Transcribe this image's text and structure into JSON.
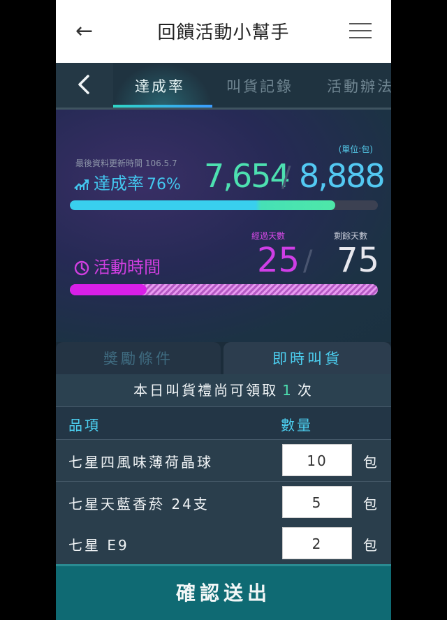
{
  "header": {
    "title": "回饋活動小幫手",
    "back_icon": "←"
  },
  "tabs": [
    {
      "label": "達成率",
      "active": true
    },
    {
      "label": "叫貨記錄",
      "active": false
    },
    {
      "label": "活動辦法",
      "active": false
    }
  ],
  "stats": {
    "unit_note": "(單位:包)",
    "last_updated": "最後資料更新時間 106.5.7",
    "rate_label": "達成率",
    "rate_percent": "76%",
    "achieved": "7,654",
    "target": "8,888",
    "separator": "/",
    "achieved_fraction": 0.861,
    "time_label": "活動時間",
    "elapsed_caption": "經過天數",
    "remaining_caption": "剩餘天數",
    "elapsed_days": "25",
    "remaining_days": "75",
    "elapsed_fraction": 0.25
  },
  "subtabs": [
    {
      "label": "獎勵條件",
      "active": false
    },
    {
      "label": "即時叫貨",
      "active": true
    }
  ],
  "notice": {
    "prefix": "本日叫貨禮尚可領取",
    "count": "1",
    "suffix": "次"
  },
  "table": {
    "headers": [
      "品項",
      "數量"
    ],
    "rows": [
      {
        "name": "七星四風味薄荷晶球",
        "qty": "10",
        "unit": "包"
      },
      {
        "name": "七星天藍香菸 24支",
        "qty": "5",
        "unit": "包"
      },
      {
        "name": "七星 E9",
        "qty": "2",
        "unit": "包"
      }
    ]
  },
  "submit_label": "確認送出",
  "colors": {
    "accent_cyan": "#43c7ef",
    "accent_green": "#4de0b0",
    "accent_magenta": "#d81fe8",
    "submit_bg": "#0f6a73"
  }
}
